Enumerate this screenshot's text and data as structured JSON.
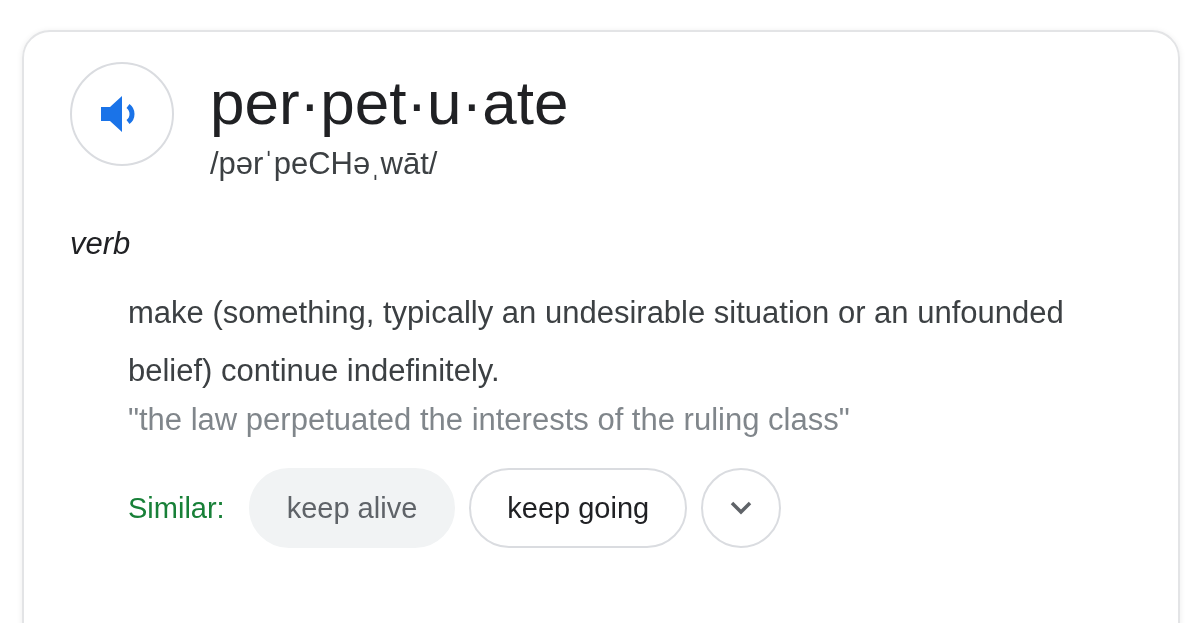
{
  "entry": {
    "word": "per·pet·u·ate",
    "pronunciation": "/pərˈpeCHəˌwāt/"
  },
  "part_of_speech": "verb",
  "definition": "make (something, typically an undesirable situation or an unfounded belief) continue indefinitely.",
  "example": "\"the law perpetuated the interests of the ruling class\"",
  "similar": {
    "label": "Similar:",
    "chips": [
      {
        "text": "keep alive",
        "kind": "filled"
      },
      {
        "text": "keep going",
        "kind": "outlined"
      }
    ]
  }
}
